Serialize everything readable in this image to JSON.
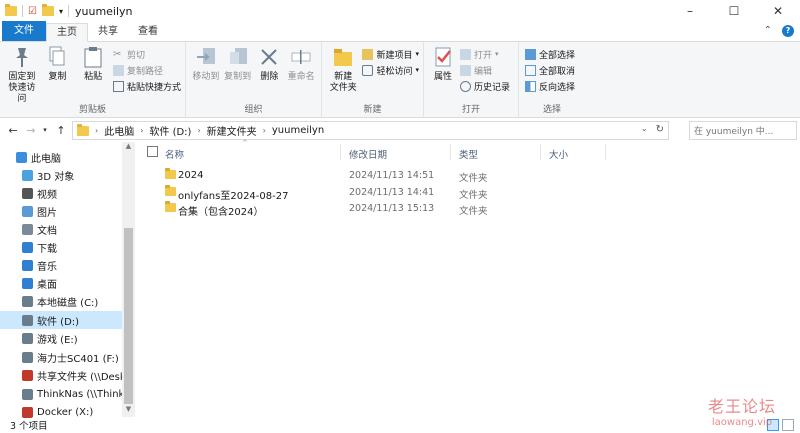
{
  "window": {
    "title": "yuumeilyn"
  },
  "tabs": [
    "文件",
    "主页",
    "共享",
    "查看"
  ],
  "ribbon": {
    "clipboard": {
      "label": "剪贴板",
      "pin": "固定到\n快速访问",
      "copy": "复制",
      "paste": "粘贴",
      "cut": "剪切",
      "copy_path": "复制路径",
      "paste_shortcut": "粘贴快捷方式"
    },
    "organize": {
      "label": "组织",
      "move_to": "移动到",
      "copy_to": "复制到",
      "delete": "删除",
      "rename": "重命名"
    },
    "new": {
      "label": "新建",
      "new_folder": "新建\n文件夹",
      "new_item": "新建项目",
      "easy_access": "轻松访问"
    },
    "open": {
      "label": "打开",
      "properties": "属性",
      "open": "打开",
      "edit": "编辑",
      "history": "历史记录"
    },
    "select": {
      "label": "选择",
      "select_all": "全部选择",
      "select_none": "全部取消",
      "invert": "反向选择"
    }
  },
  "address": {
    "crumbs": [
      "此电脑",
      "软件 (D:)",
      "新建文件夹",
      "yuumeilyn"
    ],
    "search_placeholder": "在 yuumeilyn 中..."
  },
  "nav": [
    {
      "label": "此电脑",
      "icon": "computer-icon",
      "color": "#3c8fdc"
    },
    {
      "label": "3D 对象",
      "icon": "3d-objects-icon",
      "color": "#4aa3df"
    },
    {
      "label": "视频",
      "icon": "video-icon",
      "color": "#555555"
    },
    {
      "label": "图片",
      "icon": "pictures-icon",
      "color": "#5b9bd5"
    },
    {
      "label": "文档",
      "icon": "documents-icon",
      "color": "#7a8a99"
    },
    {
      "label": "下载",
      "icon": "download-icon",
      "color": "#2f80d1"
    },
    {
      "label": "音乐",
      "icon": "music-icon",
      "color": "#2f80d1"
    },
    {
      "label": "桌面",
      "icon": "desktop-icon",
      "color": "#2f80d1"
    },
    {
      "label": "本地磁盘 (C:)",
      "icon": "drive-icon",
      "color": "#6a7d8c"
    },
    {
      "label": "软件 (D:)",
      "icon": "drive-icon",
      "color": "#6a7d8c"
    },
    {
      "label": "游戏 (E:)",
      "icon": "drive-icon",
      "color": "#6a7d8c"
    },
    {
      "label": "海力士SC401 (F:)",
      "icon": "drive-icon",
      "color": "#6a7d8c"
    },
    {
      "label": "共享文件夹 (\\\\Deskt",
      "icon": "network-drive-icon",
      "color": "#c0392b"
    },
    {
      "label": "ThinkNas (\\\\ThinkN",
      "icon": "network-drive-icon",
      "color": "#6a7d8c"
    },
    {
      "label": "Docker (X:)",
      "icon": "network-drive-icon",
      "color": "#c0392b"
    }
  ],
  "columns": {
    "name": "名称",
    "modified": "修改日期",
    "type": "类型",
    "size": "大小"
  },
  "files": [
    {
      "name": "2024",
      "modified": "2024/11/13 14:51",
      "type": "文件夹"
    },
    {
      "name": "onlyfans至2024-08-27",
      "modified": "2024/11/13 14:41",
      "type": "文件夹"
    },
    {
      "name": "合集（包含2024）",
      "modified": "2024/11/13 15:13",
      "type": "文件夹"
    }
  ],
  "status": {
    "count": "3 个项目"
  },
  "watermark": {
    "line1": "老王论坛",
    "line2": "laowang.vip"
  }
}
